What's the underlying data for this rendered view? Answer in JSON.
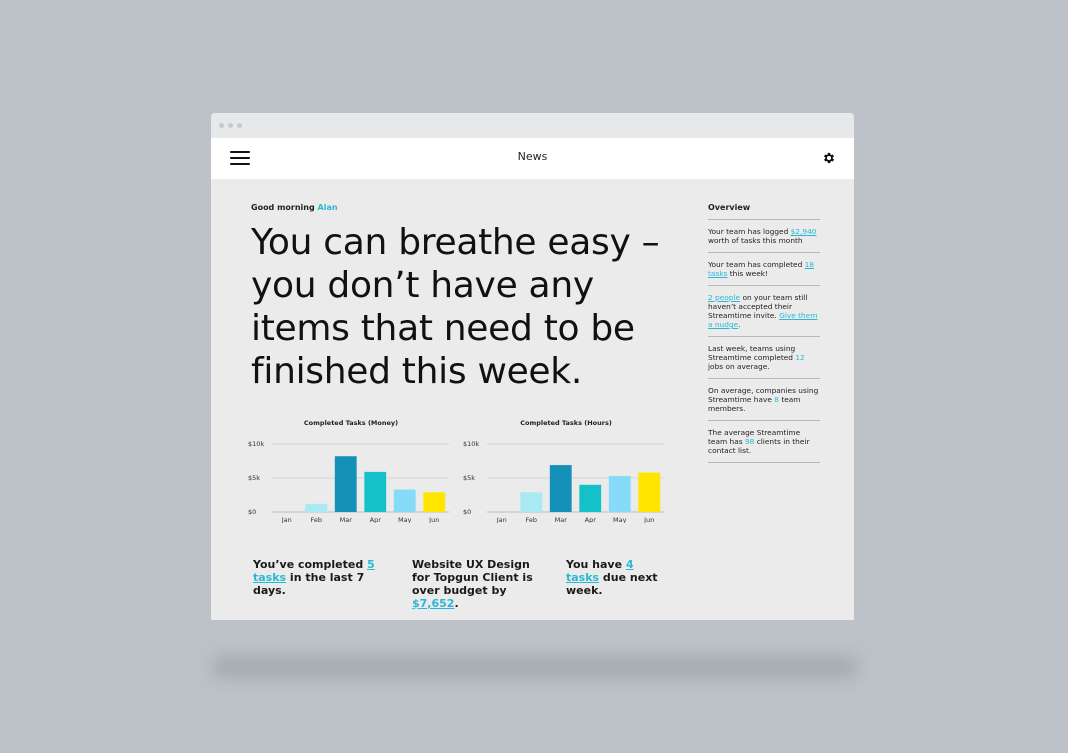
{
  "app": {
    "title": "News"
  },
  "greeting": {
    "prefix": "Good morning",
    "name": "Alan"
  },
  "headline": "You can breathe easy – you don’t have any items that need to be finished this week.",
  "overview": {
    "title": "Overview",
    "items": [
      {
        "a": "Your team has logged ",
        "link": "$2,940",
        "b": " worth of tasks this month"
      },
      {
        "a": "Your team has completed ",
        "link": "18 tasks",
        "b": " this week!"
      },
      {
        "link": "2 people",
        "a": " on your team still haven’t accepted their Streamtime invite. ",
        "link2": "Give them a nudge",
        "b": "."
      },
      {
        "a": "Last week, teams using Streamtime completed ",
        "link": "12",
        "b": " jobs on average."
      },
      {
        "a": "On average, companies using Streamtime have ",
        "link": "8",
        "b": " team members."
      },
      {
        "a": "The average Streamtime team has ",
        "link": "98",
        "b": " clients in their contact list."
      }
    ]
  },
  "stats": [
    {
      "a": "You’ve completed ",
      "link": "5 tasks",
      "b": " in the last 7 days."
    },
    {
      "a": "Website UX Design for Topgun Client is over budget by ",
      "link": "$7,652",
      "b": "."
    },
    {
      "a": "You have ",
      "link": "4 tasks",
      "b": " due next week."
    }
  ],
  "chart_data": [
    {
      "type": "bar",
      "title": "Completed Tasks (Money)",
      "categories": [
        "Jan",
        "Feb",
        "Mar",
        "Apr",
        "May",
        "Jun"
      ],
      "values": [
        0,
        1200,
        8200,
        5900,
        3300,
        2900
      ],
      "yticks": [
        "$0",
        "$5k",
        "$10k"
      ],
      "ylim": [
        0,
        10000
      ],
      "colors": [
        "#a9e9f1",
        "#a9e9f1",
        "#1590b8",
        "#14c1c9",
        "#86dcf8",
        "#ffe600"
      ],
      "grid": true
    },
    {
      "type": "bar",
      "title": "Completed Tasks (Hours)",
      "categories": [
        "Jan",
        "Feb",
        "Mar",
        "Apr",
        "May",
        "Jun"
      ],
      "values": [
        0,
        2900,
        6900,
        4000,
        5300,
        5800
      ],
      "yticks": [
        "$0",
        "$5k",
        "$10k"
      ],
      "ylim": [
        0,
        10000
      ],
      "colors": [
        "#a9e9f1",
        "#a9e9f1",
        "#1590b8",
        "#14c1c9",
        "#86dcf8",
        "#ffe600"
      ],
      "grid": true
    }
  ]
}
